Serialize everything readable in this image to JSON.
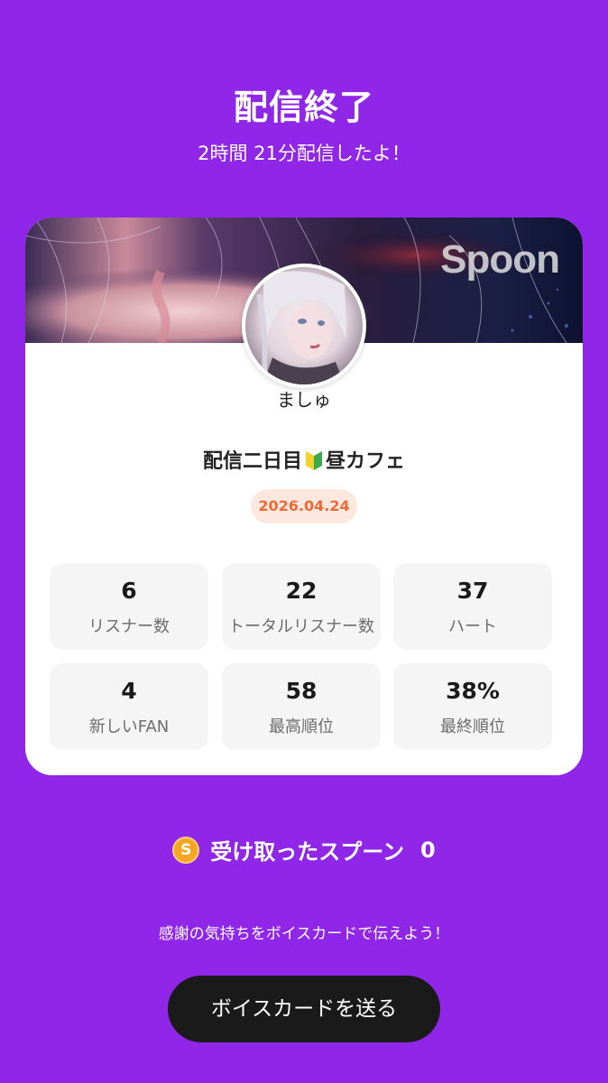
{
  "header": {
    "title": "配信終了",
    "subtitle": "2時間 21分配信したよ！"
  },
  "card": {
    "brand": "Spoon",
    "username": "ましゅ",
    "show_title_before": "配信二日目",
    "show_title_icon": "beginner-mark-icon",
    "show_title_after": "昼カフェ",
    "date": "2026.04.24",
    "stats": [
      {
        "value": "6",
        "label": "リスナー数"
      },
      {
        "value": "22",
        "label": "トータルリスナー数"
      },
      {
        "value": "37",
        "label": "ハート"
      },
      {
        "value": "4",
        "label": "新しいFAN"
      },
      {
        "value": "58",
        "label": "最高順位"
      },
      {
        "value": "38%",
        "label": "最終順位"
      }
    ]
  },
  "spoons": {
    "icon": "spoon-coin-icon",
    "coin_letter": "S",
    "label": "受け取ったスプーン",
    "count": "0"
  },
  "footer": {
    "thanks_text": "感謝の気持ちをボイスカードで伝えよう！",
    "button_label": "ボイスカードを送る"
  },
  "colors": {
    "background": "#9027e8",
    "card": "#ffffff",
    "date_text": "#ef6a35",
    "date_pill": "#fde8df",
    "button": "#1a1a1a",
    "coin": "#f6a623"
  }
}
